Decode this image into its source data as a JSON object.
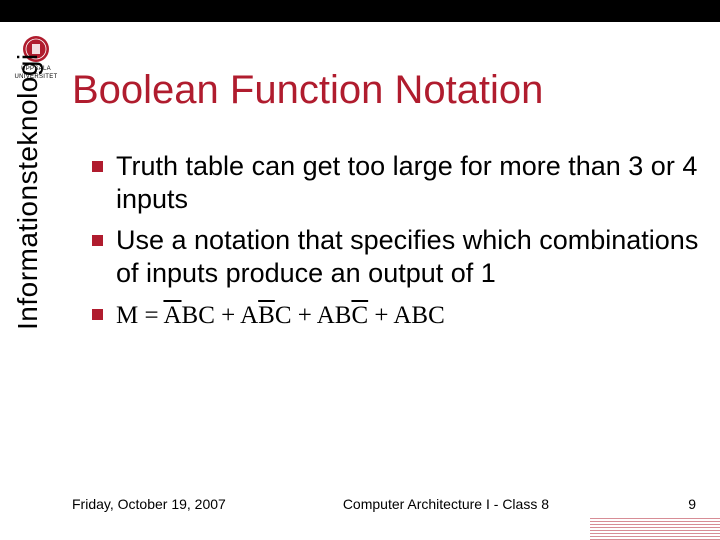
{
  "university": {
    "name_line1": "UPPSALA",
    "name_line2": "UNIVERSITET"
  },
  "title": "Boolean Function Notation",
  "sidebar_label": "Informationsteknologi",
  "bullets": [
    "Truth table can get too large for more than 3 or 4 inputs",
    "Use a notation that specifies which combinations of inputs produce an output of 1"
  ],
  "formula": {
    "lhs": "M",
    "terms": [
      {
        "a_bar": true,
        "b_bar": false,
        "c_bar": false
      },
      {
        "a_bar": false,
        "b_bar": true,
        "c_bar": false
      },
      {
        "a_bar": false,
        "b_bar": false,
        "c_bar": true
      },
      {
        "a_bar": false,
        "b_bar": false,
        "c_bar": false
      }
    ],
    "vars": [
      "A",
      "B",
      "C"
    ]
  },
  "footer": {
    "date": "Friday, October 19, 2007",
    "center": "Computer Architecture I - Class 8",
    "page": "9"
  },
  "colors": {
    "accent": "#b01c2e"
  }
}
